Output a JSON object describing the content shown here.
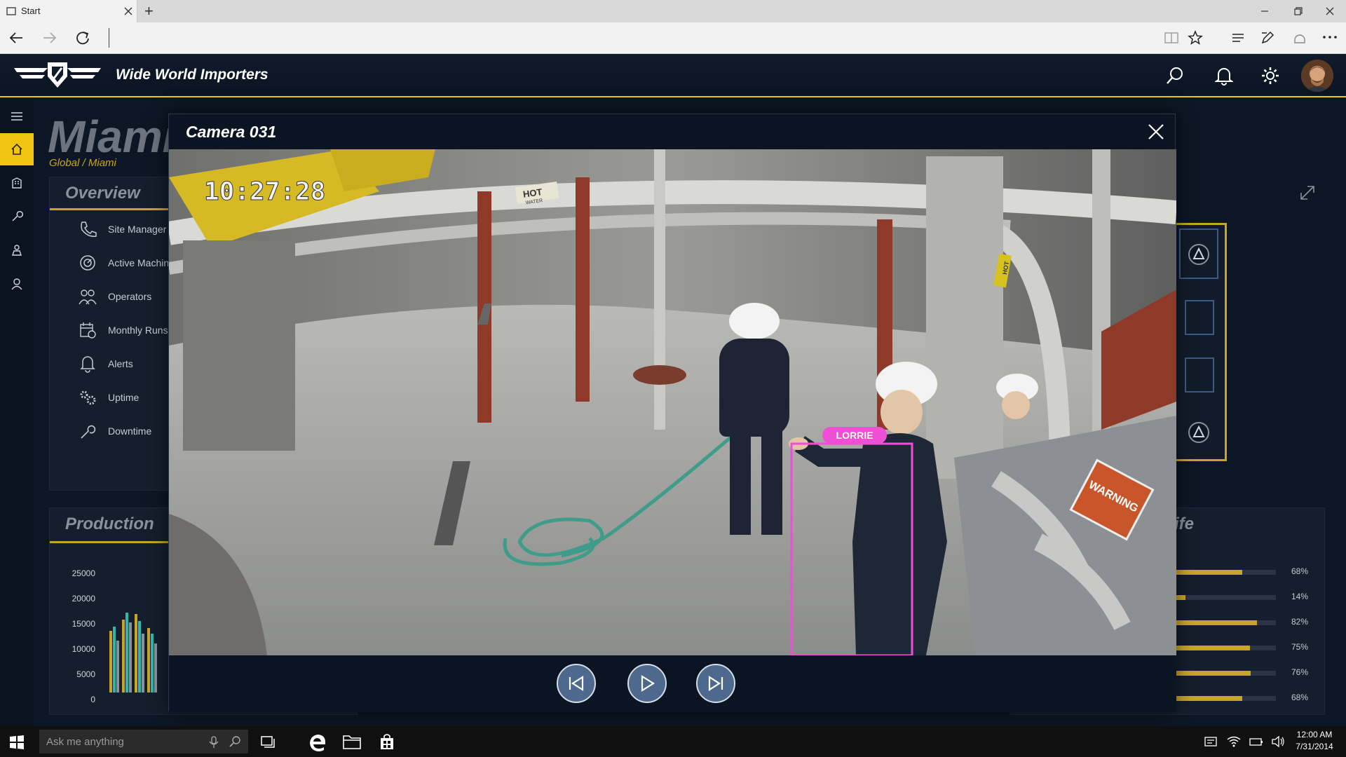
{
  "browser": {
    "tab_title": "Start",
    "new_tab_symbol": "+",
    "window_controls": [
      "minimize-icon",
      "restore-icon",
      "close-icon"
    ]
  },
  "app": {
    "brand": "Wide World Importers",
    "header_icons": [
      "search-icon",
      "bell-icon",
      "gear-icon",
      "avatar"
    ]
  },
  "sidebar": {
    "items": [
      {
        "icon": "menu-icon"
      },
      {
        "icon": "home-icon",
        "active": true
      },
      {
        "icon": "building-icon"
      },
      {
        "icon": "wrench-icon"
      },
      {
        "icon": "operator-icon"
      },
      {
        "icon": "user-icon"
      }
    ]
  },
  "page": {
    "title": "Miami",
    "breadcrumb": "Global / Miami",
    "overview": {
      "heading": "Overview",
      "items": [
        {
          "label": "Site Manager",
          "icon": "phone-icon"
        },
        {
          "label": "Active Machin",
          "icon": "gauge-icon"
        },
        {
          "label": "Operators",
          "icon": "people-icon"
        },
        {
          "label": "Monthly Runs",
          "icon": "calendar-icon"
        },
        {
          "label": "Alerts",
          "icon": "bell-icon"
        },
        {
          "label": "Uptime",
          "icon": "gears-icon"
        },
        {
          "label": "Downtime",
          "icon": "wrench-icon"
        }
      ]
    },
    "production": {
      "heading": "Production",
      "y_ticks": [
        "25000",
        "20000",
        "15000",
        "10000",
        "5000",
        "0"
      ]
    },
    "right_panel": {
      "heading_fragment": "ife",
      "percentages": [
        {
          "label": "68%",
          "value": 0.68
        },
        {
          "label": "14%",
          "value": 0.14
        },
        {
          "label": "82%",
          "value": 0.82
        },
        {
          "label": "75%",
          "value": 0.75
        },
        {
          "label": "76%",
          "value": 0.76
        },
        {
          "label": "68%",
          "value": 0.68
        }
      ]
    }
  },
  "modal": {
    "title": "Camera 031",
    "timestamp": "10:27:28",
    "detection_label": "LORRIE",
    "signs": {
      "hot": "HOT",
      "hot_sub": "WATER",
      "warning": "WARNING",
      "pillar": "HOT"
    },
    "controls": [
      {
        "name": "previous-button",
        "icon": "skip-previous-icon"
      },
      {
        "name": "play-button",
        "icon": "play-icon"
      },
      {
        "name": "next-button",
        "icon": "skip-next-icon"
      }
    ]
  },
  "taskbar": {
    "search_placeholder": "Ask me anything",
    "time": "12:00 AM",
    "date": "7/31/2014"
  }
}
